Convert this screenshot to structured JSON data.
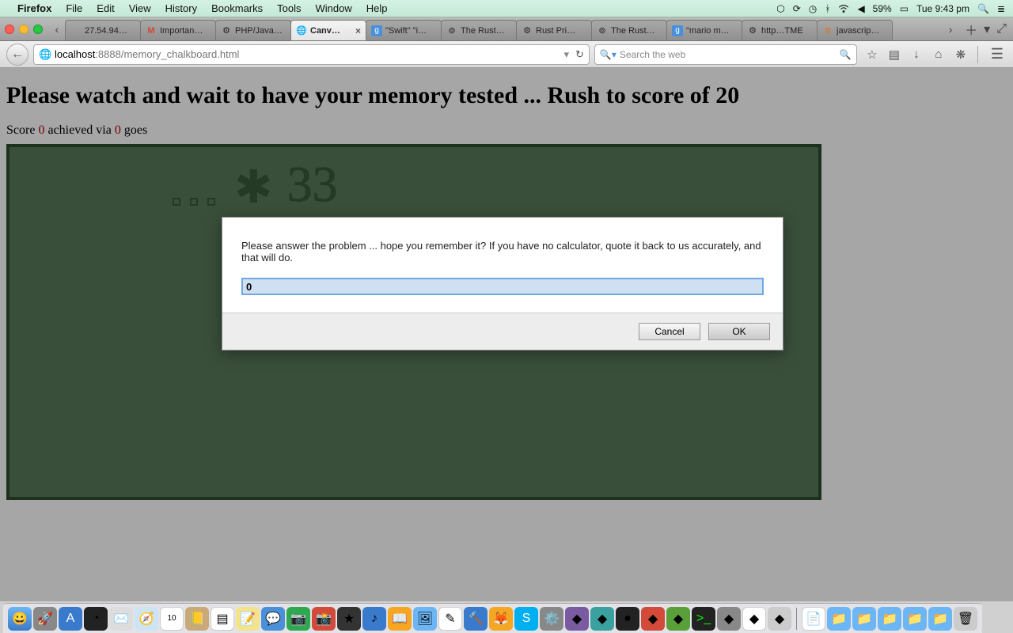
{
  "mac_menu": {
    "app_name": "Firefox",
    "items": [
      "File",
      "Edit",
      "View",
      "History",
      "Bookmarks",
      "Tools",
      "Window",
      "Help"
    ],
    "battery": "59%",
    "clock": "Tue 9:43 pm"
  },
  "tabs": [
    {
      "label": "27.54.94…",
      "icon": ""
    },
    {
      "label": "Importan…",
      "icon": "M"
    },
    {
      "label": "PHP/Java…",
      "icon": "⚙"
    },
    {
      "label": "Canv…",
      "icon": "🌐",
      "active": true
    },
    {
      "label": "\"Swift\" \"i…",
      "icon": "g"
    },
    {
      "label": "The Rust…",
      "icon": "⊚"
    },
    {
      "label": "Rust Pri…",
      "icon": "⚙"
    },
    {
      "label": "The Rust…",
      "icon": "⊚"
    },
    {
      "label": "\"mario m…",
      "icon": "g"
    },
    {
      "label": "http…TME",
      "icon": "⚙"
    },
    {
      "label": "javascrip…",
      "icon": "≣"
    }
  ],
  "url": {
    "host": "localhost",
    "port": ":8888",
    "path": "/memory_chalkboard.html"
  },
  "search": {
    "placeholder": "Search the web"
  },
  "page": {
    "title": "Please watch and wait to have your memory tested ... Rush to score of 20",
    "score_prefix": "Score ",
    "score_value": "0",
    "score_mid": " achieved via ",
    "goes_value": "0",
    "score_suffix": " goes",
    "chalk_number": "33"
  },
  "prompt": {
    "message": "Please answer the problem ... hope you remember it?  If you have no calculator, quote it back to us accurately, and that will do.",
    "value": "0",
    "cancel": "Cancel",
    "ok": "OK"
  }
}
